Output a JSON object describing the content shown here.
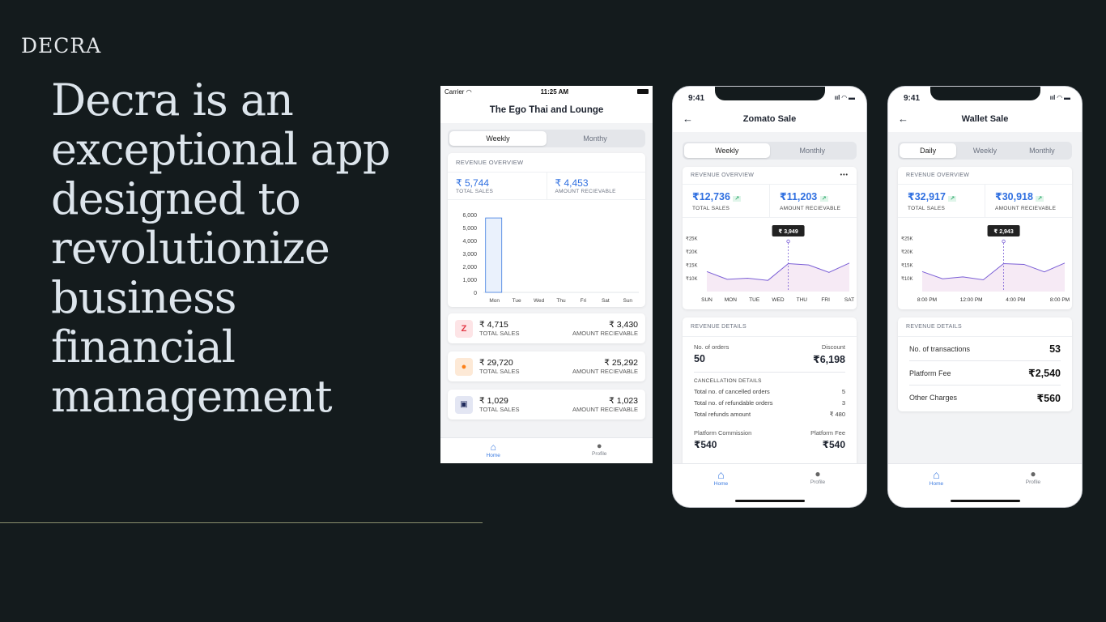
{
  "brand": "DECRA",
  "headline": "Decra is an exceptional app designed to revolutionize business financial management",
  "phone1": {
    "status": {
      "carrier": "Carrier",
      "time": "11:25 AM"
    },
    "title": "The Ego Thai and Lounge",
    "tabs": [
      "Weekly",
      "Monthy"
    ],
    "overview_label": "REVENUE OVERVIEW",
    "total_sales": "₹ 5,744",
    "total_sales_label": "TOTAL SALES",
    "amount_receivable": "₹ 4,453",
    "amount_receivable_label": "AMOUNT RECIEVABLE",
    "platforms": [
      {
        "icon": "zomato-icon",
        "sales": "₹ 4,715",
        "sales_label": "TOTAL SALES",
        "receivable": "₹ 3,430",
        "receivable_label": "AMOUNT RECIEVABLE"
      },
      {
        "icon": "swiggy-icon",
        "sales": "₹ 29,720",
        "sales_label": "TOTAL SALES",
        "receivable": "₹ 25,292",
        "receivable_label": "AMOUNT RECIEVABLE"
      },
      {
        "icon": "wallet-icon",
        "sales": "₹ 1,029",
        "sales_label": "TOTAL SALES",
        "receivable": "₹ 1,023",
        "receivable_label": "AMOUNT RECIEVABLE"
      }
    ],
    "nav": [
      "Home",
      "Profile"
    ]
  },
  "phone2": {
    "time": "9:41",
    "title": "Zomato Sale",
    "tabs": [
      "Weekly",
      "Monthly"
    ],
    "overview_label": "REVENUE OVERVIEW",
    "total_sales": "₹12,736",
    "total_sales_label": "TOTAL SALES",
    "amount_receivable": "₹11,203",
    "amount_receivable_label": "AMOUNT RECIEVABLE",
    "tooltip": "₹ 3,949",
    "details_label": "REVENUE DETAILS",
    "orders_label": "No. of orders",
    "orders": "50",
    "discount_label": "Discount",
    "discount": "₹6,198",
    "cancel_label": "CANCELLATION DETAILS",
    "cancel_rows": [
      {
        "label": "Total no. of cancelled orders",
        "value": "5"
      },
      {
        "label": "Total no. of refundable orders",
        "value": "3"
      },
      {
        "label": "Total refunds amount",
        "value": "₹ 480"
      }
    ],
    "commission_label": "Platform Commission",
    "commission": "₹540",
    "fee_label": "Platform Fee",
    "fee": "₹540",
    "nav": [
      "Home",
      "Profile"
    ]
  },
  "phone3": {
    "time": "9:41",
    "title": "Wallet Sale",
    "tabs": [
      "Daily",
      "Weekly",
      "Monthly"
    ],
    "overview_label": "REVENUE OVERVIEW",
    "total_sales": "₹32,917",
    "total_sales_label": "TOTAL SALES",
    "amount_receivable": "₹30,918",
    "amount_receivable_label": "AMOUNT RECIEVABLE",
    "tooltip": "₹ 2,943",
    "details_label": "REVENUE DETAILS",
    "rows": [
      {
        "label": "No. of transactions",
        "value": "53"
      },
      {
        "label": "Platform Fee",
        "value": "₹2,540"
      },
      {
        "label": "Other Charges",
        "value": "₹560"
      }
    ],
    "nav": [
      "Home",
      "Profile"
    ]
  },
  "chart_data": [
    {
      "type": "bar",
      "categories": [
        "Mon",
        "Tue",
        "Wed",
        "Thu",
        "Fri",
        "Sat",
        "Sun"
      ],
      "values": [
        5744,
        0,
        0,
        0,
        0,
        0,
        0
      ],
      "yticks": [
        "6,000",
        "5,000",
        "4,000",
        "3,000",
        "2,000",
        "1,000",
        "0"
      ],
      "ylim": [
        0,
        6000
      ],
      "colors": {
        "bar": "#eaf1fc",
        "border": "#3b7ae0"
      }
    },
    {
      "type": "area",
      "categories": [
        "SUN",
        "MON",
        "TUE",
        "WED",
        "THU",
        "FRI",
        "SAT"
      ],
      "yticks": [
        "₹25K",
        "₹20K",
        "₹15K",
        "₹10K"
      ],
      "ylim": [
        5000,
        27500
      ],
      "values": [
        12500,
        9600,
        10000,
        9200,
        15500,
        15000,
        12200,
        15700
      ],
      "colors": {
        "line": "#7b5fd6",
        "fill": "#f4e6f3"
      }
    },
    {
      "type": "area",
      "categories": [
        "8:00 PM",
        "12:00 PM",
        "4:00 PM",
        "8:00 PM"
      ],
      "yticks": [
        "₹25K",
        "₹20K",
        "₹15K",
        "₹10K"
      ],
      "ylim": [
        5000,
        27500
      ],
      "values": [
        12500,
        9800,
        10500,
        9400,
        15500,
        15200,
        12400,
        15700
      ],
      "colors": {
        "line": "#7b5fd6",
        "fill": "#f4e6f3"
      }
    }
  ]
}
